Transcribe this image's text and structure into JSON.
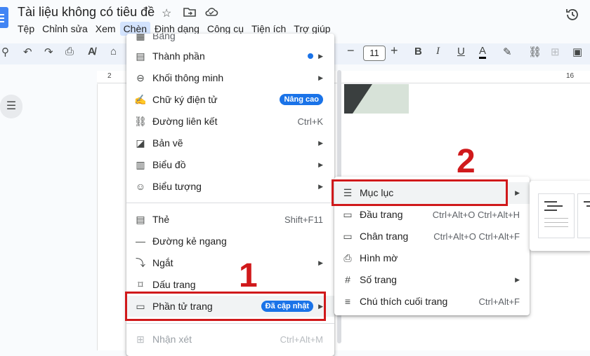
{
  "title": "Tài liệu không có tiêu đề",
  "menubar": [
    "Tệp",
    "Chỉnh sửa",
    "Xem",
    "Chèn",
    "Định dạng",
    "Công cụ",
    "Tiện ích",
    "Trợ giúp"
  ],
  "menubar_active": "Chèn",
  "toolbar": {
    "font_size": "11"
  },
  "ruler_numbers": [
    "2",
    "16"
  ],
  "insert_menu": {
    "cut_top_label": "Bảng",
    "items": [
      {
        "icon": "components-icon",
        "label": "Thành phần",
        "arrow": "▶",
        "dot": true
      },
      {
        "icon": "smart-chips-icon",
        "label": "Khối thông minh",
        "arrow": "▶"
      },
      {
        "icon": "signature-icon",
        "label": "Chữ ký điện tử",
        "badge": "Nâng cao"
      },
      {
        "icon": "link-icon",
        "label": "Đường liên kết",
        "shortcut": "Ctrl+K"
      },
      {
        "icon": "drawing-icon",
        "label": "Bản vẽ",
        "arrow": "▶"
      },
      {
        "icon": "chart-icon",
        "label": "Biểu đồ",
        "arrow": "▶"
      },
      {
        "icon": "emoji-icon",
        "label": "Biểu tượng",
        "arrow": "▶"
      },
      {
        "icon": "tab-icon",
        "label": "Thẻ",
        "shortcut": "Shift+F11"
      },
      {
        "icon": "horizontal-line-icon",
        "label": "Đường kẻ ngang"
      },
      {
        "icon": "break-icon",
        "label": "Ngắt",
        "arrow": "▶"
      },
      {
        "icon": "bookmark-icon",
        "label": "Dấu trang"
      },
      {
        "icon": "page-elements-icon",
        "label": "Phần tử trang",
        "badge": "Đã cập nhật",
        "arrow": "▶"
      },
      {
        "icon": "comment-icon",
        "label": "Nhận xét",
        "shortcut": "Ctrl+Alt+M",
        "disabled": true
      }
    ]
  },
  "page_elements_submenu": {
    "items": [
      {
        "icon": "table-of-contents-icon",
        "label": "Mục lục",
        "arrow": "▶"
      },
      {
        "icon": "header-icon",
        "label": "Đầu trang",
        "shortcut": "Ctrl+Alt+O Ctrl+Alt+H"
      },
      {
        "icon": "footer-icon",
        "label": "Chân trang",
        "shortcut": "Ctrl+Alt+O Ctrl+Alt+F"
      },
      {
        "icon": "watermark-icon",
        "label": "Hình mờ"
      },
      {
        "icon": "page-number-icon",
        "label": "Số trang",
        "arrow": "▶"
      },
      {
        "icon": "footnote-icon",
        "label": "Chú thích cuối trang",
        "shortcut": "Ctrl+Alt+F"
      }
    ]
  },
  "annotations": {
    "step1": "1",
    "step2": "2"
  },
  "colors": {
    "highlight": "#d0191b",
    "accent": "#1a73e8",
    "menubar_active_bg": "#d3e3fd"
  }
}
